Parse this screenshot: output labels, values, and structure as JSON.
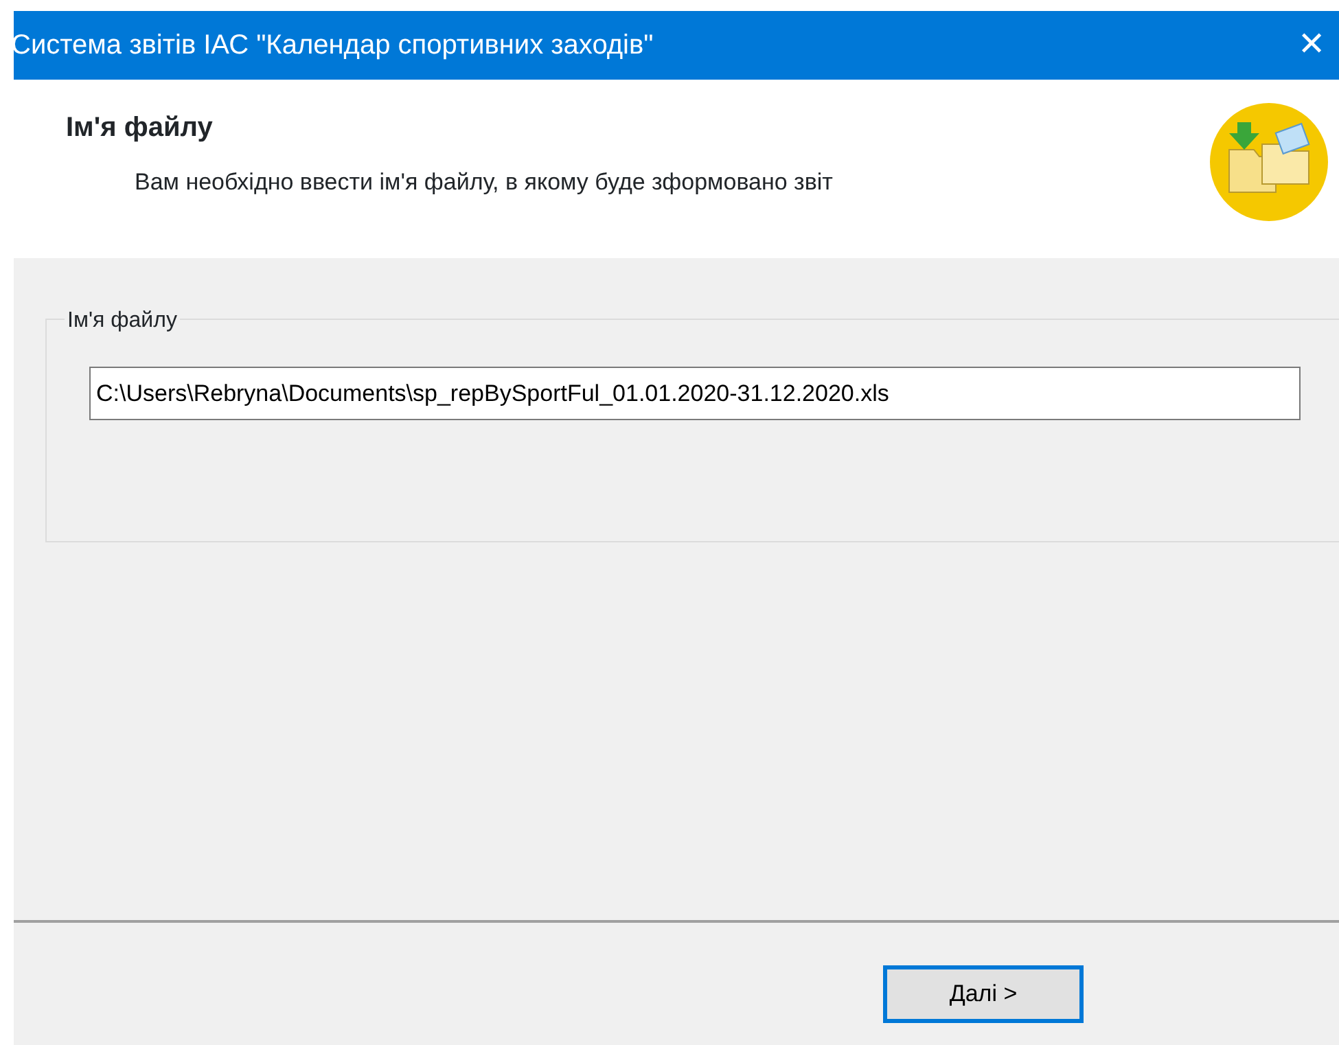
{
  "window": {
    "title": "Система звітів ІАС \"Календар спортивних заходів\"",
    "close": "✕"
  },
  "header": {
    "title": "Ім'я файлу",
    "subtitle": "Вам необхідно ввести ім'я файлу, в якому буде зформовано звіт"
  },
  "group": {
    "legend": "Ім'я файлу",
    "value": "C:\\Users\\Rebryna\\Documents\\sp_repBySportFul_01.01.2020-31.12.2020.xls"
  },
  "buttons": [
    {
      "label": "Далі >",
      "focused": true
    }
  ]
}
